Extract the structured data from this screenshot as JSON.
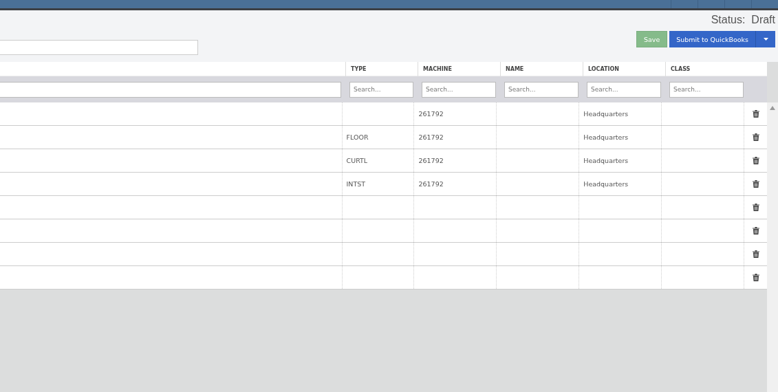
{
  "status": "Status:  Draft",
  "buttons": {
    "save": "Save",
    "submit": "Submit to QuickBooks"
  },
  "table": {
    "columns": [
      {
        "label": "TYPE",
        "placeholder": "Search..."
      },
      {
        "label": "MACHINE",
        "placeholder": "Search..."
      },
      {
        "label": "NAME",
        "placeholder": "Search..."
      },
      {
        "label": "LOCATION",
        "placeholder": "Search..."
      },
      {
        "label": "CLASS",
        "placeholder": "Search..."
      }
    ],
    "rows": [
      {
        "cells": [
          null,
          "261792",
          null,
          "Headquarters",
          null
        ]
      },
      {
        "cells": [
          "FLOOR",
          "261792",
          null,
          "Headquarters",
          null
        ]
      },
      {
        "cells": [
          "CURTL",
          "261792",
          null,
          "Headquarters",
          null
        ]
      },
      {
        "cells": [
          "INTST",
          "261792",
          null,
          "Headquarters",
          null
        ]
      },
      {
        "cells": [
          null,
          null,
          null,
          null,
          null
        ]
      },
      {
        "cells": [
          null,
          null,
          null,
          null,
          null
        ]
      },
      {
        "cells": [
          null,
          null,
          null,
          null,
          null
        ]
      },
      {
        "cells": [
          null,
          null,
          null,
          null,
          null
        ]
      }
    ]
  }
}
